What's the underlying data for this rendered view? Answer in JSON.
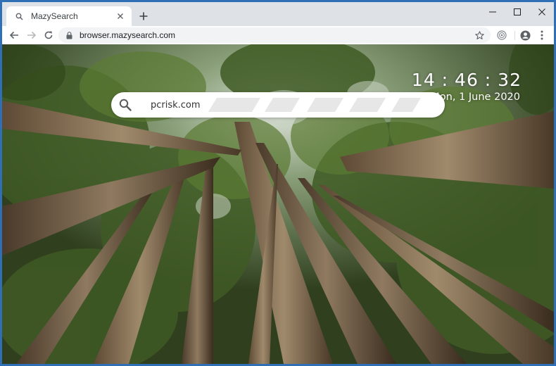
{
  "browser": {
    "tab": {
      "title": "MazySearch",
      "icon": "search-icon"
    },
    "address_bar": {
      "url": "browser.mazysearch.com",
      "icon": "lock-icon"
    },
    "window_controls": [
      "minimize-icon",
      "maximize-icon",
      "close-icon"
    ],
    "toolbar_icons": [
      "back-arrow-icon",
      "forward-arrow-icon",
      "reload-icon",
      "star-icon",
      "extension-icon",
      "profile-icon",
      "menu-icon"
    ]
  },
  "page": {
    "clock": "14 : 46 : 32",
    "date": "Mon, 1 June 2020",
    "search": {
      "value": "pcrisk.com",
      "icon": "search-icon"
    },
    "background": "forest-canopy-photo"
  },
  "colors": {
    "frame_border": "#2f6fb5",
    "tabstrip": "#dee1e6",
    "toolbar": "#ffffff",
    "omnibox": "#f1f3f4"
  }
}
